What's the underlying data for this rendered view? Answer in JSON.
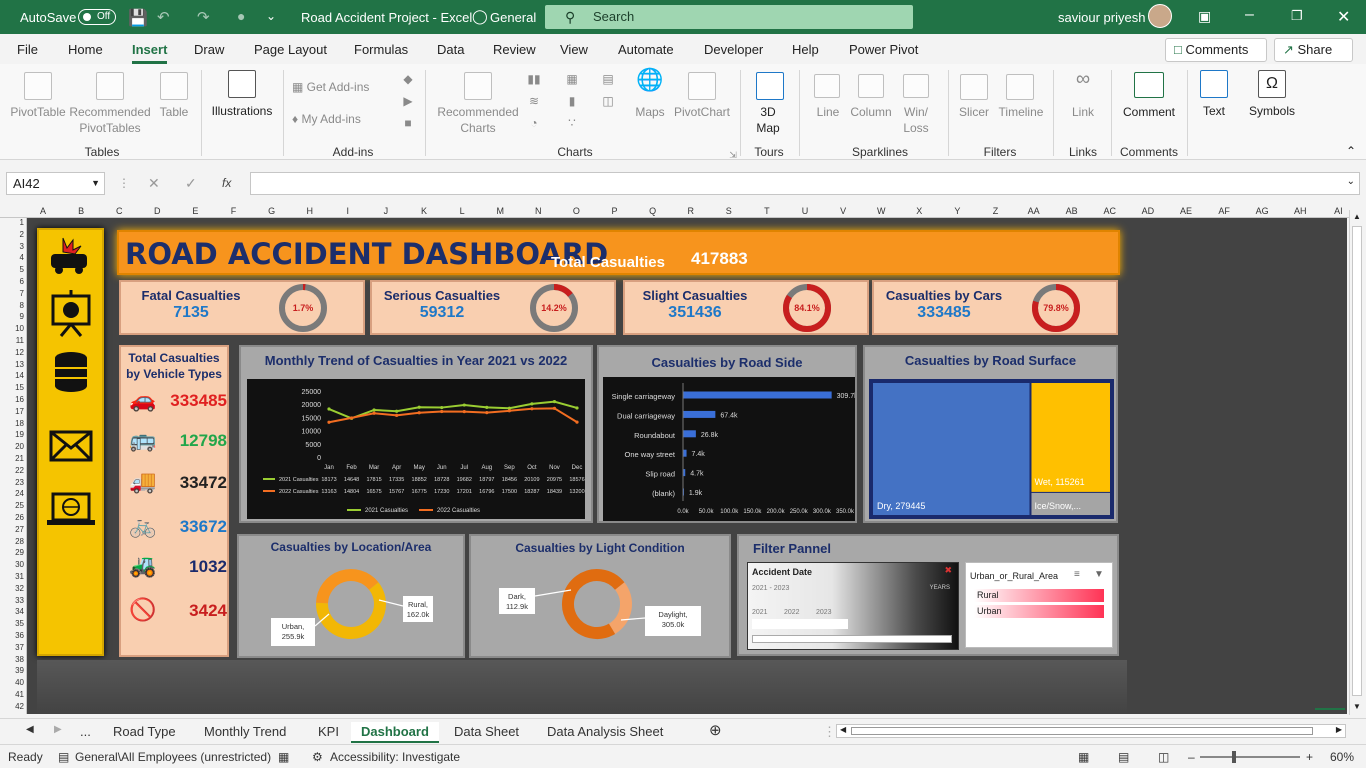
{
  "titlebar": {
    "autosave": "AutoSave",
    "autosave_state": "Off",
    "doc_title": "Road Accident Project  -  Excel",
    "sensitivity": "General",
    "search_placeholder": "Search",
    "user": "saviour priyesh"
  },
  "menu": {
    "items": [
      "File",
      "Home",
      "Insert",
      "Draw",
      "Page Layout",
      "Formulas",
      "Data",
      "Review",
      "View",
      "Automate",
      "Developer",
      "Help",
      "Power Pivot"
    ],
    "comments_btn": "Comments",
    "share_btn": "Share"
  },
  "ribbon": {
    "pivottable": "PivotTable",
    "recommended_pivot": "Recommended",
    "recommended_pivot2": "PivotTables",
    "table": "Table",
    "illustrations": "Illustrations",
    "get_addins": "Get Add-ins",
    "my_addins": "My Add-ins",
    "recommended_charts": "Recommended",
    "recommended_charts2": "Charts",
    "maps": "Maps",
    "pivotchart": "PivotChart",
    "map3d": "3D",
    "map3d2": "Map",
    "line": "Line",
    "column": "Column",
    "winloss": "Win/",
    "winloss2": "Loss",
    "slicer": "Slicer",
    "timeline": "Timeline",
    "link": "Link",
    "comment": "Comment",
    "text": "Text",
    "symbols": "Symbols",
    "groups": [
      "Tables",
      "Add-ins",
      "Charts",
      "Tours",
      "Sparklines",
      "Filters",
      "Links",
      "Comments"
    ]
  },
  "formula": {
    "namebox": "AI42",
    "fx": "fx"
  },
  "columns": [
    "A",
    "B",
    "C",
    "D",
    "E",
    "F",
    "G",
    "H",
    "I",
    "J",
    "K",
    "L",
    "M",
    "N",
    "O",
    "P",
    "Q",
    "R",
    "S",
    "T",
    "U",
    "V",
    "W",
    "X",
    "Y",
    "Z",
    "AA",
    "AB",
    "AC",
    "AD",
    "AE",
    "AF",
    "AG",
    "AH",
    "AI"
  ],
  "rows": [
    "1",
    "2",
    "3",
    "4",
    "5",
    "6",
    "7",
    "8",
    "9",
    "10",
    "11",
    "12",
    "13",
    "14",
    "15",
    "16",
    "17",
    "18",
    "19",
    "20",
    "21",
    "22",
    "23",
    "24",
    "25",
    "26",
    "27",
    "28",
    "29",
    "30",
    "31",
    "32",
    "33",
    "34",
    "35",
    "36",
    "37",
    "38",
    "39",
    "40",
    "41",
    "42"
  ],
  "dashboard": {
    "title": "ROAD ACCIDENT DASHBOARD",
    "total_label": "Total Casualties",
    "total_value": "417883",
    "kpis": [
      {
        "label": "Fatal Casualties",
        "value": "7135",
        "pct": "1.7%",
        "fraction": 0.017
      },
      {
        "label": "Serious Casualties",
        "value": "59312",
        "pct": "14.2%",
        "fraction": 0.142
      },
      {
        "label": "Slight Casualties",
        "value": "351436",
        "pct": "84.1%",
        "fraction": 0.841
      },
      {
        "label": "Casualties by Cars",
        "value": "333485",
        "pct": "79.8%",
        "fraction": 0.798
      }
    ],
    "vehicle_title": "Total Casualties by Vehicle Types",
    "vehicles": [
      {
        "icon": "car-icon",
        "value": "333485",
        "color": "#e02020"
      },
      {
        "icon": "bus-icon",
        "value": "12798",
        "color": "#22a64a"
      },
      {
        "icon": "truck-icon",
        "value": "33472",
        "color": "#222222"
      },
      {
        "icon": "bicycle-icon",
        "value": "33672",
        "color": "#1e78c8"
      },
      {
        "icon": "tractor-icon",
        "value": "1032",
        "color": "#1a2a6c"
      },
      {
        "icon": "no-entry-icon",
        "value": "3424",
        "color": "#c81e1e"
      }
    ],
    "filter_title": "Filter Pannel",
    "accident_date_label": "Accident Date",
    "date_range": "2021 - 2023",
    "date_level": "YEARS",
    "years": [
      "2021",
      "2022",
      "2023"
    ],
    "area_slicer_title": "Urban_or_Rural_Area",
    "area_options": [
      "Rural",
      "Urban"
    ]
  },
  "chart_data": [
    {
      "type": "line",
      "title": "Monthly Trend of Casualties in Year 2021  vs 2022",
      "categories": [
        "Jan",
        "Feb",
        "Mar",
        "Apr",
        "May",
        "Jun",
        "Jul",
        "Aug",
        "Sep",
        "Oct",
        "Nov",
        "Dec"
      ],
      "ylim": [
        0,
        25000
      ],
      "yticks": [
        "25000",
        "20000",
        "15000",
        "10000",
        "5000",
        "0"
      ],
      "series": [
        {
          "name": "2021 Casualties",
          "color": "#9acd32",
          "values": [
            18173,
            14648,
            17815,
            17335,
            18852,
            18728,
            19682,
            18797,
            18456,
            20109,
            20975,
            18576
          ]
        },
        {
          "name": "2022 Casualties",
          "color": "#f26d21",
          "values": [
            13163,
            14804,
            16575,
            15767,
            16775,
            17230,
            17201,
            16796,
            17500,
            18287,
            18439,
            13200
          ]
        }
      ]
    },
    {
      "type": "bar",
      "title": "Casualties by Road Side",
      "categories": [
        "Single carriageway",
        "Dual carriageway",
        "Roundabout",
        "One way street",
        "Slip road",
        "(blank)"
      ],
      "values": [
        309700,
        67400,
        26800,
        7400,
        4700,
        1900
      ],
      "labels": [
        "309.7k",
        "67.4k",
        "26.8k",
        "7.4k",
        "4.7k",
        "1.9k"
      ],
      "xticks": [
        "0.0k",
        "50.0k",
        "100.0k",
        "150.0k",
        "200.0k",
        "250.0k",
        "300.0k",
        "350.0k"
      ],
      "xlim": [
        0,
        350000
      ]
    },
    {
      "type": "treemap",
      "title": "Casualties by Road Surface",
      "labels": [
        "Dry, 279445",
        "Wet, 115261",
        "Ice/Snow,..."
      ],
      "values": [
        279445,
        115261,
        23177
      ]
    },
    {
      "type": "pie",
      "title": "Casualties by Location/Area",
      "labels": [
        "Urban, 255.9k",
        "Rural, 162.0k"
      ],
      "values": [
        255900,
        162000
      ]
    },
    {
      "type": "pie",
      "title": "Casualties by Light Condition",
      "labels": [
        "Dark, 112.9k",
        "Daylight, 305.0k"
      ],
      "values": [
        112900,
        305000
      ]
    }
  ],
  "tabs": {
    "items": [
      "...",
      "Road Type",
      "Monthly Trend",
      "KPI",
      "Dashboard",
      "Data Sheet",
      "Data Analysis Sheet"
    ],
    "active": "Dashboard"
  },
  "status": {
    "ready": "Ready",
    "sensitivity": "General\\All Employees (unrestricted)",
    "accessibility": "Accessibility: Investigate",
    "zoom": "60%"
  }
}
